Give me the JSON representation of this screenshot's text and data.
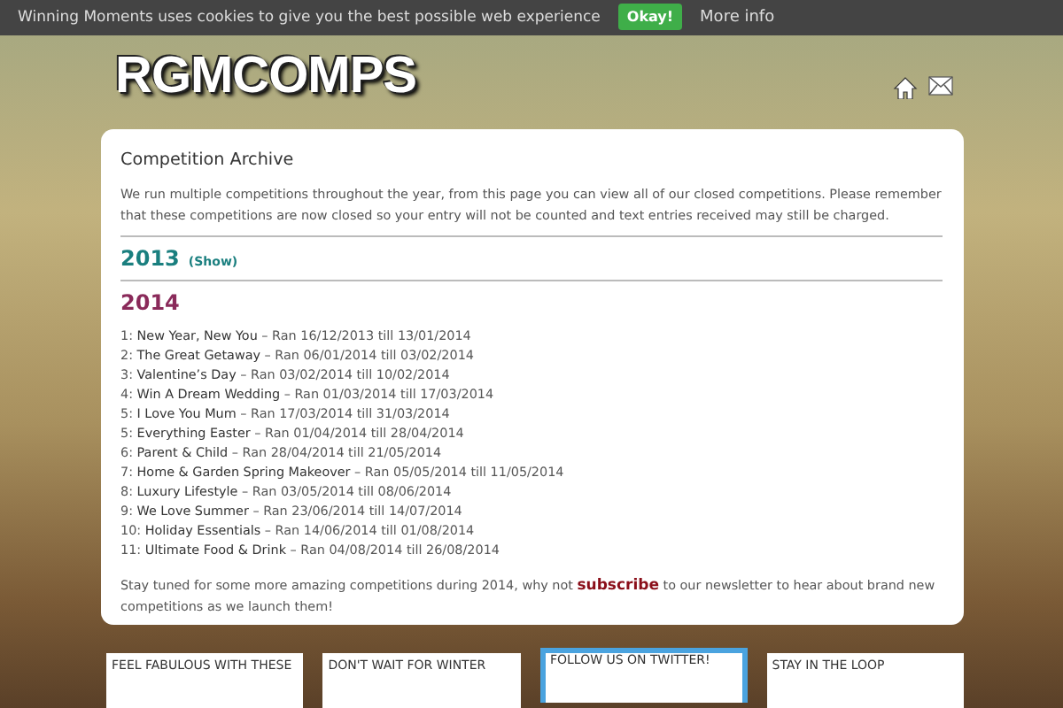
{
  "cookie_bar": {
    "message": "Winning Moments uses cookies to give you the best possible web experience",
    "accept_button": "Okay!",
    "more_link": "More info"
  },
  "header": {
    "logo": "RGMCOMPS"
  },
  "archive": {
    "title": "Competition Archive",
    "intro": "We run multiple competitions throughout the year, from this page you can view all of our closed competitions. Please remember that these competitions are now closed so your entry will not be counted and text entries received may still be charged.",
    "years": [
      {
        "year": "2013",
        "toggle": "(Show)",
        "expanded": false
      },
      {
        "year": "2014",
        "expanded": true,
        "items": [
          {
            "number": "1:",
            "name": "New Year, New You",
            "dates": "– Ran 16/12/2013 till 13/01/2014"
          },
          {
            "number": "2:",
            "name": "The Great Getaway",
            "dates": "– Ran 06/01/2014 till 03/02/2014"
          },
          {
            "number": "3:",
            "name": "Valentine’s Day",
            "dates": "– Ran 03/02/2014 till 10/02/2014"
          },
          {
            "number": "4:",
            "name": "Win A Dream Wedding",
            "dates": "– Ran 01/03/2014 till 17/03/2014"
          },
          {
            "number": "5:",
            "name": "I Love You Mum",
            "dates": "– Ran 17/03/2014 till 31/03/2014"
          },
          {
            "number": "5:",
            "name": "Everything Easter",
            "dates": "– Ran 01/04/2014 till 28/04/2014"
          },
          {
            "number": "6:",
            "name": "Parent & Child",
            "dates": "– Ran 28/04/2014 till 21/05/2014"
          },
          {
            "number": "7:",
            "name": "Home & Garden Spring Makeover",
            "dates": "– Ran 05/05/2014 till 11/05/2014"
          },
          {
            "number": "8:",
            "name": "Luxury Lifestyle",
            "dates": "– Ran 03/05/2014 till 08/06/2014"
          },
          {
            "number": "9:",
            "name": "We Love Summer",
            "dates": "– Ran 23/06/2014 till 14/07/2014"
          },
          {
            "number": "10:",
            "name": "Holiday Essentials",
            "dates": "– Ran 14/06/2014 till 01/08/2014"
          },
          {
            "number": "11:",
            "name": "Ultimate Food & Drink",
            "dates": "– Ran 04/08/2014 till 26/08/2014"
          }
        ]
      }
    ],
    "outro_before": "Stay tuned for some more amazing competitions during 2014, why not",
    "outro_link": "subscribe",
    "outro_after": "to our newsletter to hear about brand new competitions as we launch them!"
  },
  "footer_boxes": [
    {
      "title": "FEEL FABULOUS WITH THESE",
      "kind": "plain"
    },
    {
      "title": "DON'T WAIT FOR WINTER",
      "kind": "plain"
    },
    {
      "title": "FOLLOW US ON TWITTER!",
      "kind": "twitter"
    },
    {
      "title": "STAY IN THE LOOP",
      "kind": "plain"
    }
  ]
}
